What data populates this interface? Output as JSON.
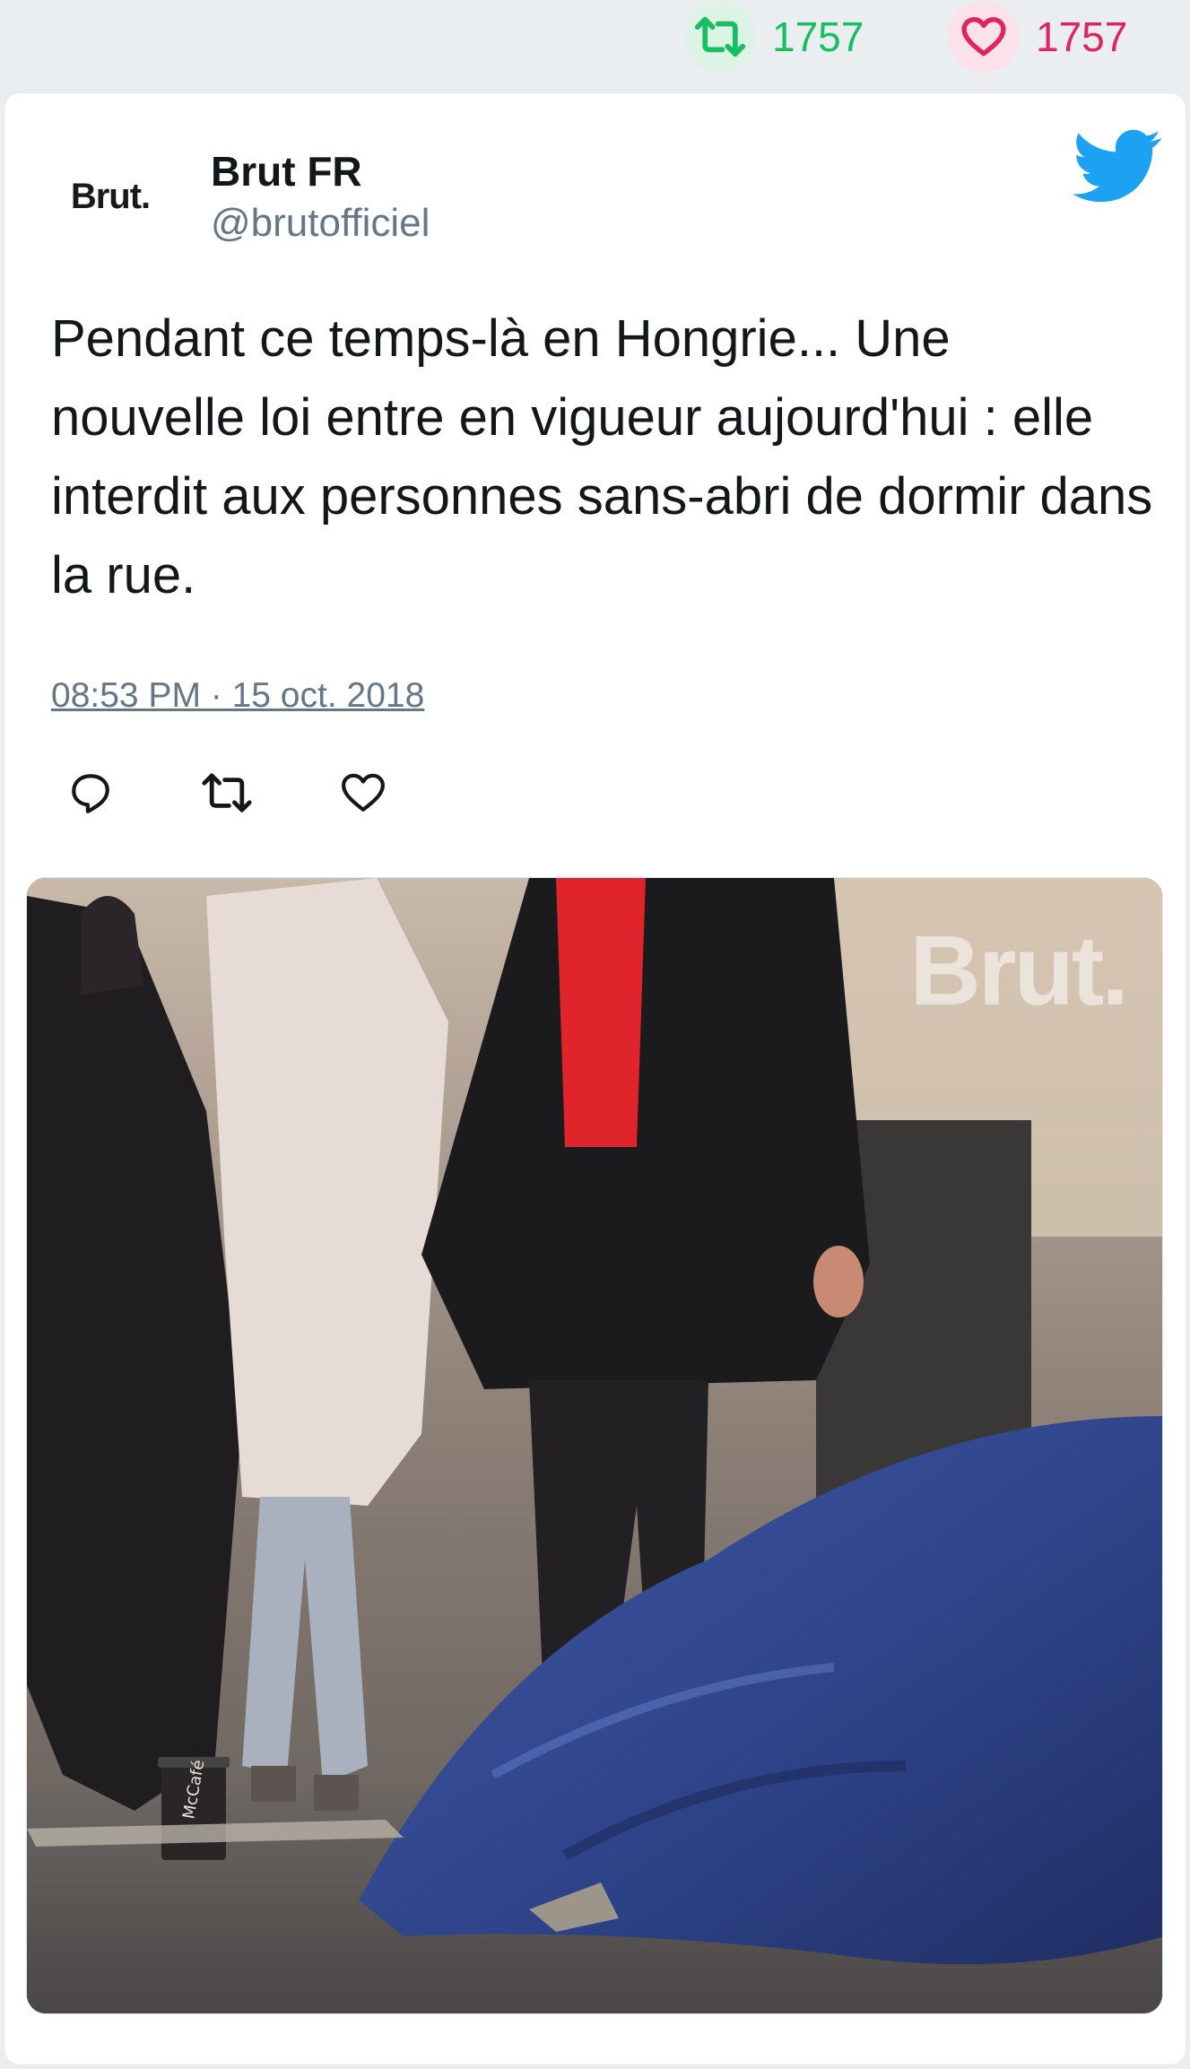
{
  "stats": {
    "retweet_count": "1757",
    "like_count": "1757"
  },
  "author": {
    "avatar_text": "Brut.",
    "name": "Brut FR",
    "handle": "@brutofficiel"
  },
  "tweet": {
    "text": "Pendant ce temps-là en Hongrie... Une nouvelle loi entre en vigueur aujourd'hui : elle interdit aux personnes sans-abri de dormir dans la rue.",
    "timestamp": "08:53 PM · 15 oct. 2018"
  },
  "media": {
    "watermark": "Brut.",
    "cup_label": "McCafé"
  },
  "colors": {
    "retweet": "#17bf63",
    "like": "#e0245e",
    "twitter_blue": "#1da1f2",
    "text": "#14171a",
    "muted": "#657786"
  },
  "icons": [
    "retweet-icon",
    "heart-icon",
    "twitter-bird-icon",
    "reply-icon"
  ]
}
